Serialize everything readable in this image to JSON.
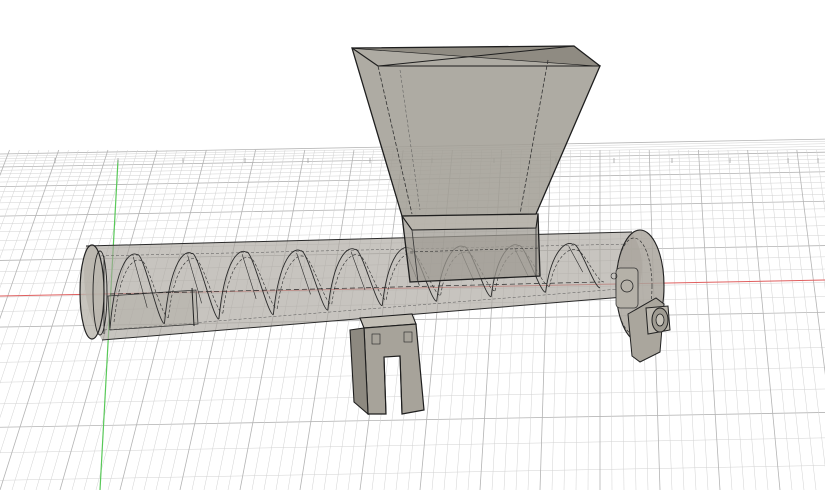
{
  "viewport": {
    "background": "#ffffff",
    "grid_minor_color": "#d2d2d2",
    "grid_major_color": "#b4b4b4",
    "x_axis_color": "#e06060",
    "y_axis_color": "#58c858",
    "model_fill": "#a9a59c",
    "model_edge": "#1e1e1e"
  },
  "model": {
    "parts": [
      {
        "name": "hopper"
      },
      {
        "name": "hopper-throat"
      },
      {
        "name": "barrel"
      },
      {
        "name": "auger-screw"
      },
      {
        "name": "end-cap"
      },
      {
        "name": "drive-coupling"
      },
      {
        "name": "support-stand"
      }
    ]
  },
  "grid": {
    "tick_labels": [
      "",
      "",
      "",
      "",
      "",
      "",
      "",
      "",
      "",
      "",
      "",
      "",
      "",
      ""
    ]
  }
}
